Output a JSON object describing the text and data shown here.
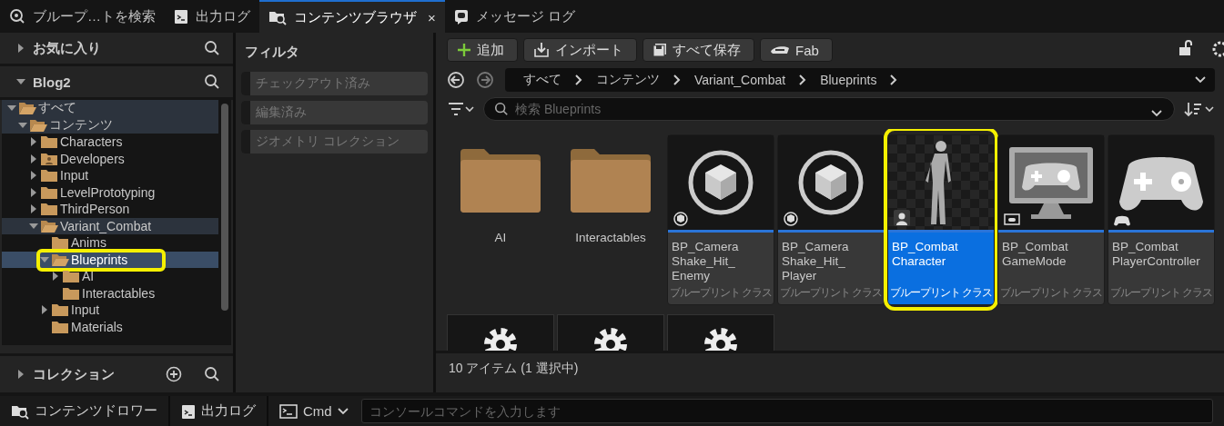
{
  "tabs": [
    {
      "label": "ブループ…トを検索",
      "kind": "search",
      "selected": false
    },
    {
      "label": "出力ログ",
      "kind": "log",
      "selected": false
    },
    {
      "label": "コンテンツブラウザ",
      "kind": "browser",
      "selected": true,
      "close": "×"
    },
    {
      "label": "メッセージ ログ",
      "kind": "message",
      "selected": false
    }
  ],
  "sidebar": {
    "favorites": {
      "label": "お気に入り",
      "expanded": false
    },
    "project": {
      "label": "Blog2",
      "expanded": true
    },
    "tree": [
      {
        "label": "すべて",
        "expanded": true,
        "in_path": true,
        "selected": false,
        "children": [
          {
            "label": "コンテンツ",
            "expanded": true,
            "in_path": true,
            "selected": false,
            "children": [
              {
                "label": "Characters",
                "expanded": false,
                "selected": false
              },
              {
                "label": "Developers",
                "kind": "developer",
                "expanded": false,
                "selected": false
              },
              {
                "label": "Input",
                "expanded": false,
                "selected": false
              },
              {
                "label": "LevelPrototyping",
                "expanded": false,
                "selected": false
              },
              {
                "label": "ThirdPerson",
                "expanded": false,
                "selected": false
              },
              {
                "label": "Variant_Combat",
                "expanded": true,
                "in_path": true,
                "selected": false,
                "children": [
                  {
                    "label": "Anims",
                    "selected": false
                  },
                  {
                    "label": "Blueprints",
                    "expanded": true,
                    "selected": true,
                    "highlighted": true,
                    "children": [
                      {
                        "label": "AI",
                        "expanded": false,
                        "selected": false
                      },
                      {
                        "label": "Interactables",
                        "selected": false
                      }
                    ]
                  },
                  {
                    "label": "Input",
                    "expanded": false,
                    "selected": false
                  },
                  {
                    "label": "Materials",
                    "selected": false
                  }
                ]
              }
            ]
          }
        ]
      }
    ],
    "collections": {
      "label": "コレクション",
      "expanded": false
    }
  },
  "filters": {
    "title": "フィルタ",
    "items": [
      {
        "label": "チェックアウト済み",
        "checked": false
      },
      {
        "label": "編集済み",
        "checked": false
      },
      {
        "label": "ジオメトリ コレクション",
        "checked": false
      }
    ]
  },
  "toolbar": [
    {
      "label": "追加",
      "kind": "add"
    },
    {
      "label": "インポート",
      "kind": "import"
    },
    {
      "label": "すべて保存",
      "kind": "save"
    },
    {
      "label": "Fab",
      "kind": "fab"
    }
  ],
  "breadcrumb": [
    "すべて",
    "コンテンツ",
    "Variant_Combat",
    "Blueprints"
  ],
  "search": {
    "placeholder": "検索 Blueprints"
  },
  "assets": [
    {
      "kind": "folder",
      "name": "AI",
      "selected": false,
      "highlighted": false
    },
    {
      "kind": "folder",
      "name": "Interactables",
      "selected": false,
      "highlighted": false
    },
    {
      "kind": "cube",
      "name": "BP_Camera Shake_Hit_ Enemy",
      "type": "ブループリント クラス",
      "selected": false,
      "highlighted": false
    },
    {
      "kind": "cube",
      "name": "BP_Camera Shake_Hit_ Player",
      "type": "ブループリント クラス",
      "selected": false,
      "highlighted": false
    },
    {
      "kind": "character",
      "name": "BP_Combat Character",
      "type": "ブループリント クラス",
      "selected": true,
      "highlighted": true
    },
    {
      "kind": "gamemode",
      "name": "BP_Combat GameMode",
      "type": "ブループリント クラス",
      "selected": false,
      "highlighted": false
    },
    {
      "kind": "gamepad",
      "name": "BP_Combat PlayerController",
      "type": "ブループリント クラス",
      "selected": false,
      "highlighted": false
    },
    {
      "kind": "gear",
      "selected": false
    },
    {
      "kind": "gear",
      "selected": false
    },
    {
      "kind": "gear",
      "selected": false
    }
  ],
  "status": "10 アイテム (1 選択中)",
  "bottom_bar": {
    "drawer": "コンテンツドロワー",
    "output": "出力ログ",
    "cmd": "Cmd",
    "console": {
      "placeholder": "コンソールコマンドを入力します"
    }
  }
}
